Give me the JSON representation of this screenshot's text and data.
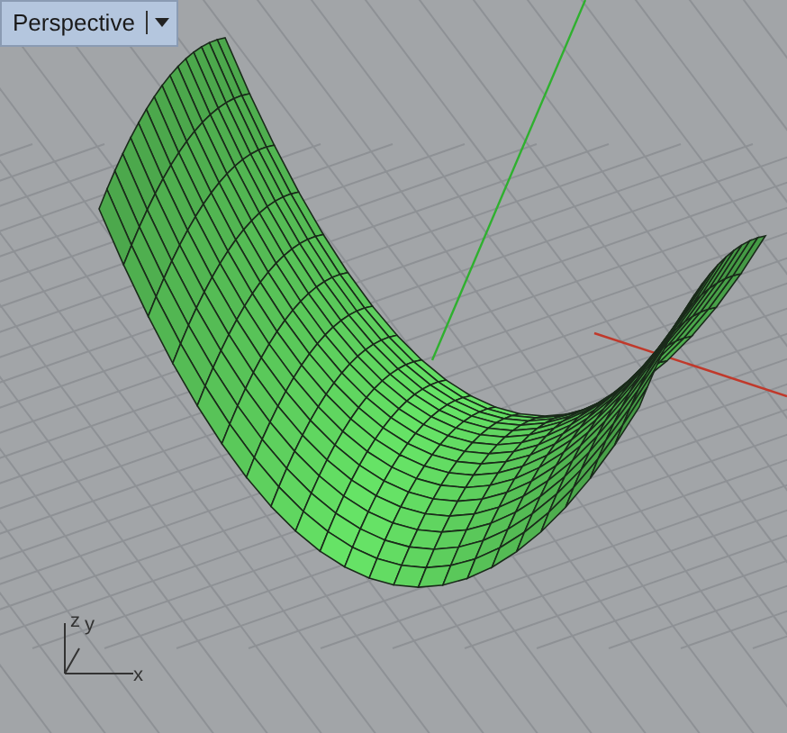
{
  "viewport": {
    "title": "Perspective"
  },
  "axis_indicator": {
    "labels": [
      "z",
      "y",
      "x"
    ]
  }
}
